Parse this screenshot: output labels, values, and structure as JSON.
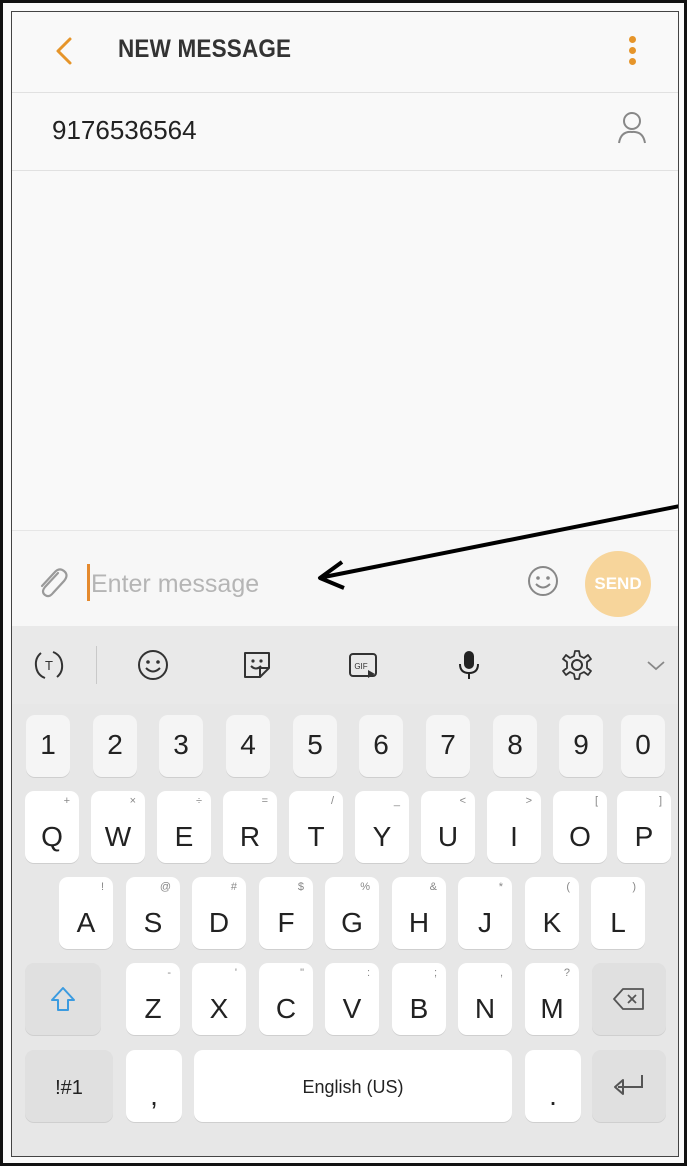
{
  "header": {
    "title": "NEW MESSAGE",
    "back_icon": "chevron-left-icon",
    "menu_icon": "more-vertical-icon",
    "accent": "#e6952a"
  },
  "recipient": {
    "number": "9176536564",
    "contact_icon": "person-icon"
  },
  "compose": {
    "placeholder": "Enter message",
    "send_label": "SEND",
    "attach_icon": "paperclip-icon",
    "emoji_icon": "smiley-icon"
  },
  "toolbar": {
    "icons": [
      "text-mode-icon",
      "emoji-icon",
      "sticker-icon",
      "gif-icon",
      "microphone-icon",
      "settings-gear-icon",
      "chevron-down-icon"
    ]
  },
  "keyboard": {
    "numbers": [
      "1",
      "2",
      "3",
      "4",
      "5",
      "6",
      "7",
      "8",
      "9",
      "0"
    ],
    "row_q": [
      {
        "k": "Q",
        "s": "+"
      },
      {
        "k": "W",
        "s": "×"
      },
      {
        "k": "E",
        "s": "÷"
      },
      {
        "k": "R",
        "s": "="
      },
      {
        "k": "T",
        "s": "/"
      },
      {
        "k": "Y",
        "s": "_"
      },
      {
        "k": "U",
        "s": "<"
      },
      {
        "k": "I",
        "s": ">"
      },
      {
        "k": "O",
        "s": "["
      },
      {
        "k": "P",
        "s": "]"
      }
    ],
    "row_a": [
      {
        "k": "A",
        "s": "!"
      },
      {
        "k": "S",
        "s": "@"
      },
      {
        "k": "D",
        "s": "#"
      },
      {
        "k": "F",
        "s": "$"
      },
      {
        "k": "G",
        "s": "%"
      },
      {
        "k": "H",
        "s": "&"
      },
      {
        "k": "J",
        "s": "*"
      },
      {
        "k": "K",
        "s": "("
      },
      {
        "k": "L",
        "s": ")"
      }
    ],
    "row_z": [
      {
        "k": "Z",
        "s": "-"
      },
      {
        "k": "X",
        "s": "'"
      },
      {
        "k": "C",
        "s": "\""
      },
      {
        "k": "V",
        "s": ":"
      },
      {
        "k": "B",
        "s": ";"
      },
      {
        "k": "N",
        "s": ","
      },
      {
        "k": "M",
        "s": "?"
      }
    ],
    "symbols_label": "!#1",
    "comma_label": ",",
    "space_label": "English (US)",
    "period_label": ".",
    "shift_icon": "shift-arrow-icon",
    "backspace_icon": "backspace-icon",
    "enter_icon": "enter-return-icon"
  }
}
